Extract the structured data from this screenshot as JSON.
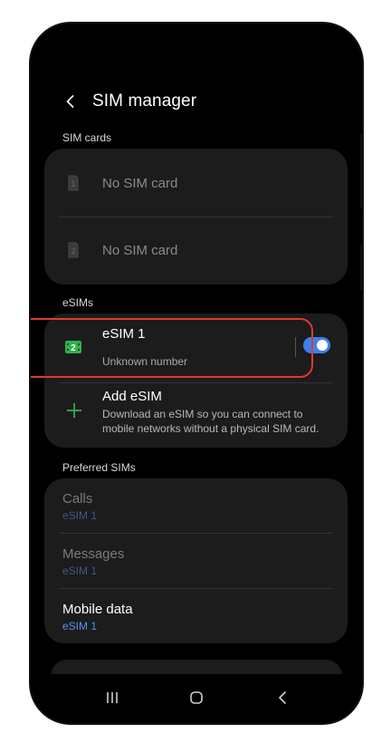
{
  "header": {
    "title": "SIM manager"
  },
  "sections": {
    "sim_cards_label": "SIM cards",
    "esims_label": "eSIMs",
    "preferred_label": "Preferred SIMs"
  },
  "sim_cards": [
    {
      "slot": "1",
      "label": "No SIM card"
    },
    {
      "slot": "2",
      "label": "No SIM card"
    }
  ],
  "esim": {
    "slot": "2",
    "name": "eSIM 1",
    "number": "Unknown number",
    "enabled": true
  },
  "add_esim": {
    "title": "Add eSIM",
    "description": "Download an eSIM so you can connect to mobile networks without a physical SIM card."
  },
  "preferred": [
    {
      "label": "Calls",
      "value": "eSIM 1"
    },
    {
      "label": "Messages",
      "value": "eSIM 1"
    },
    {
      "label": "Mobile data",
      "value": "eSIM 1"
    }
  ],
  "colors": {
    "accent": "#3d7ff0",
    "highlight": "#e03a2f",
    "esim_green": "#2fb24a"
  },
  "icons": [
    "back-arrow-icon",
    "sim-card-icon",
    "esim-icon",
    "plus-icon",
    "recents-icon",
    "home-icon",
    "back-icon"
  ]
}
